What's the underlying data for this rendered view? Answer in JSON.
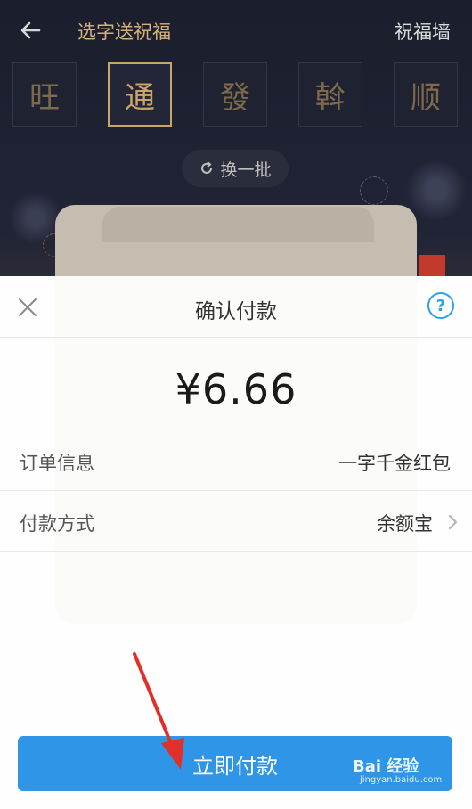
{
  "header": {
    "title": "选字送祝福",
    "right_link": "祝福墙",
    "back_icon": "arrow-left-icon"
  },
  "characters": [
    "旺",
    "通",
    "發",
    "斡",
    "顺"
  ],
  "selected_character_index": 1,
  "refresh": {
    "label": "换一批",
    "icon": "refresh-icon"
  },
  "payment": {
    "title": "确认付款",
    "close_icon": "close-icon",
    "help_icon": "help-icon",
    "help_glyph": "?",
    "amount": "¥6.66",
    "order": {
      "label": "订单信息",
      "value": "一字千金红包"
    },
    "method": {
      "label": "付款方式",
      "value": "余额宝",
      "chevron_icon": "chevron-right-icon"
    },
    "pay_button": "立即付款"
  },
  "watermark": {
    "logo": "Bai 经验",
    "url": "jingyan.baidu.com"
  },
  "colors": {
    "accent": "#2f95e6",
    "gold": "#c9a56a",
    "dark_bg": "#1a1d2a"
  }
}
